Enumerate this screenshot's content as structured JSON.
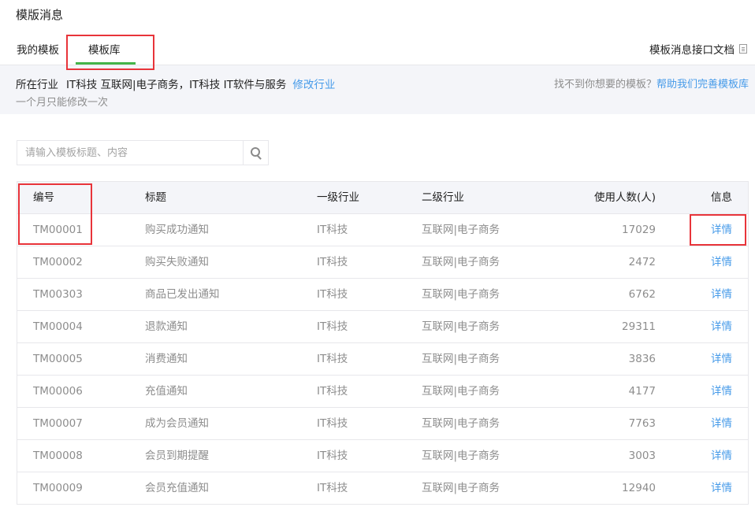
{
  "page": {
    "title": "模版消息"
  },
  "tabs": [
    {
      "label": "我的模板",
      "active": false
    },
    {
      "label": "模板库",
      "active": true
    }
  ],
  "doc_link": {
    "label": "模板消息接口文档",
    "icon": "document-icon"
  },
  "industry": {
    "label": "所在行业",
    "value": "IT科技 互联网|电子商务，IT科技 IT软件与服务",
    "modify": "修改行业",
    "note": "一个月只能修改一次",
    "help_prefix": "找不到你想要的模板？",
    "help_link": "帮助我们完善模板库"
  },
  "search": {
    "placeholder": "请输入模板标题、内容",
    "icon": "search-icon"
  },
  "table": {
    "headers": [
      "编号",
      "标题",
      "一级行业",
      "二级行业",
      "使用人数(人)",
      "信息"
    ],
    "rows": [
      [
        "TM00001",
        "购买成功通知",
        "IT科技",
        "互联网|电子商务",
        "17029",
        "详情"
      ],
      [
        "TM00002",
        "购买失败通知",
        "IT科技",
        "互联网|电子商务",
        "2472",
        "详情"
      ],
      [
        "TM00303",
        "商品已发出通知",
        "IT科技",
        "互联网|电子商务",
        "6762",
        "详情"
      ],
      [
        "TM00004",
        "退款通知",
        "IT科技",
        "互联网|电子商务",
        "29311",
        "详情"
      ],
      [
        "TM00005",
        "消费通知",
        "IT科技",
        "互联网|电子商务",
        "3836",
        "详情"
      ],
      [
        "TM00006",
        "充值通知",
        "IT科技",
        "互联网|电子商务",
        "4177",
        "详情"
      ],
      [
        "TM00007",
        "成为会员通知",
        "IT科技",
        "互联网|电子商务",
        "7763",
        "详情"
      ],
      [
        "TM00008",
        "会员到期提醒",
        "IT科技",
        "互联网|电子商务",
        "3003",
        "详情"
      ],
      [
        "TM00009",
        "会员充值通知",
        "IT科技",
        "互联网|电子商务",
        "12940",
        "详情"
      ]
    ]
  },
  "colors": {
    "accent_green": "#44b549",
    "link_blue": "#459ae9",
    "highlight_red": "#e8343a"
  }
}
